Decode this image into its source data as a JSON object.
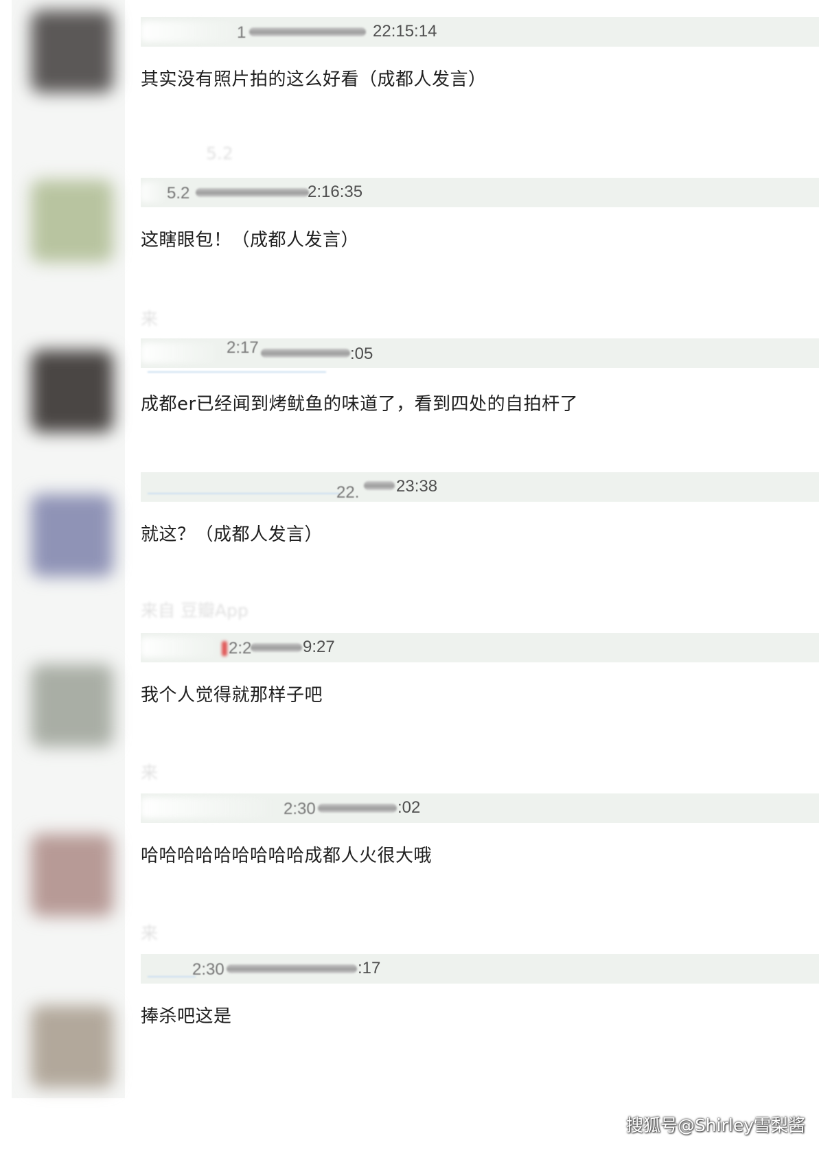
{
  "comments": [
    {
      "timestamp": "22:15:14",
      "prefix": "1",
      "above_label": "",
      "text": "其实没有照片拍的这么好看（成都人发言）"
    },
    {
      "timestamp": "2:16:35",
      "prefix": "5.2",
      "above_label": "5.2",
      "text": "这瞎眼包！（成都人发言）"
    },
    {
      "timestamp": ":05",
      "prefix": "2:17",
      "above_label": "来",
      "text": "成都er已经闻到烤鱿鱼的味道了，看到四处的自拍杆了"
    },
    {
      "timestamp": "23:38",
      "prefix": "22.",
      "above_label": "",
      "text": "就这？（成都人发言）"
    },
    {
      "timestamp": "9:27",
      "prefix": "2:2",
      "above_label": "来自 豆瓣App",
      "text": "我个人觉得就那样子吧"
    },
    {
      "timestamp": ":02",
      "prefix": "2:30",
      "above_label": "来",
      "text": "哈哈哈哈哈哈哈哈哈成都人火很大哦"
    },
    {
      "timestamp": ":17",
      "prefix": "2:30",
      "above_label": "来",
      "text": "捧杀吧这是"
    }
  ],
  "watermark": "搜狐号@Shirley雪梨酱",
  "colors": {
    "meta_bar": "#eef2ee",
    "avatar_column": "#f5f6f5",
    "text": "#1f1f1f",
    "timestamp": "#4f4f4f"
  }
}
